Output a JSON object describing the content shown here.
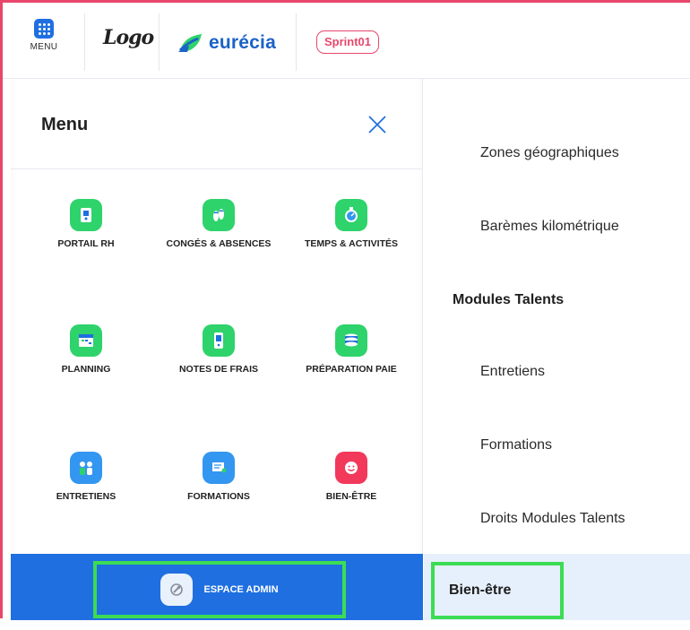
{
  "header": {
    "menu_label": "MENU",
    "logo_text": "Logo",
    "brand_name": "eurécia",
    "sprint_badge": "Sprint01"
  },
  "menu": {
    "title": "Menu",
    "tiles": [
      {
        "label": "PORTAIL RH",
        "icon": "portal-icon",
        "color": "#2ed36b"
      },
      {
        "label": "CONGÉS & ABSENCES",
        "icon": "sandals-icon",
        "color": "#2ed36b"
      },
      {
        "label": "TEMPS & ACTIVITÉS",
        "icon": "stopwatch-icon",
        "color": "#2ed36b"
      },
      {
        "label": "PLANNING",
        "icon": "calendar-icon",
        "color": "#2ed36b"
      },
      {
        "label": "NOTES DE FRAIS",
        "icon": "phone-receipt-icon",
        "color": "#2ed36b"
      },
      {
        "label": "PRÉPARATION PAIE",
        "icon": "coins-icon",
        "color": "#2ed36b"
      },
      {
        "label": "ENTRETIENS",
        "icon": "people-icon",
        "color": "#3396f0"
      },
      {
        "label": "FORMATIONS",
        "icon": "presentation-icon",
        "color": "#3396f0"
      },
      {
        "label": "BIEN-ÊTRE",
        "icon": "smile-icon",
        "color": "#f2395b"
      }
    ],
    "admin_label": "ESPACE ADMIN"
  },
  "right": {
    "items": [
      {
        "label": "Zones géographiques",
        "kind": "item"
      },
      {
        "label": "Barèmes kilométrique",
        "kind": "item"
      },
      {
        "label": "Modules Talents",
        "kind": "heading"
      },
      {
        "label": "Entretiens",
        "kind": "item"
      },
      {
        "label": "Formations",
        "kind": "item"
      },
      {
        "label": "Droits Modules Talents",
        "kind": "item"
      }
    ],
    "active_label": "Bien-être"
  },
  "colors": {
    "accent_blue": "#1f6fe0",
    "highlight_green": "#3cdc54",
    "frame_pink": "#e8466b"
  }
}
